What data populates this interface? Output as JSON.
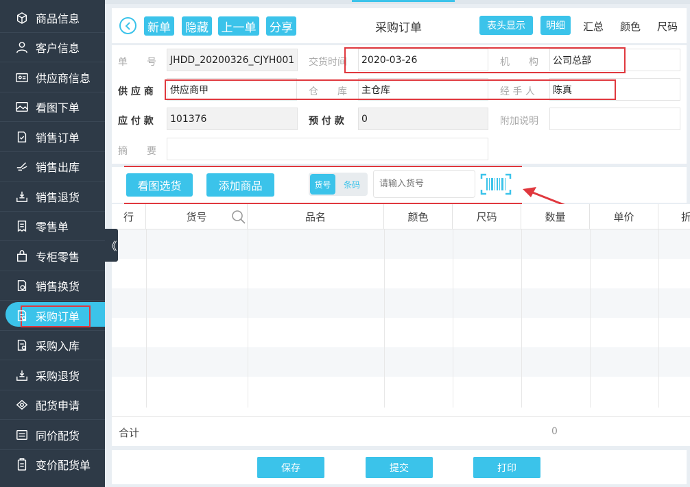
{
  "sidebar": {
    "items": [
      {
        "label": "商品信息",
        "icon": "box-icon"
      },
      {
        "label": "客户信息",
        "icon": "person-icon"
      },
      {
        "label": "供应商信息",
        "icon": "id-card-icon"
      },
      {
        "label": "看图下单",
        "icon": "image-icon"
      },
      {
        "label": "销售订单",
        "icon": "order-check-icon"
      },
      {
        "label": "销售出库",
        "icon": "hand-out-icon"
      },
      {
        "label": "销售退货",
        "icon": "tray-return-icon"
      },
      {
        "label": "零售单",
        "icon": "receipt-icon"
      },
      {
        "label": "专柜零售",
        "icon": "bag-icon"
      },
      {
        "label": "销售换货",
        "icon": "exchange-icon"
      },
      {
        "label": "采购订单",
        "icon": "purchase-order-icon"
      },
      {
        "label": "采购入库",
        "icon": "purchase-in-icon"
      },
      {
        "label": "采购退货",
        "icon": "purchase-return-icon"
      },
      {
        "label": "配货申请",
        "icon": "apply-icon"
      },
      {
        "label": "同价配货",
        "icon": "same-price-icon"
      },
      {
        "label": "变价配货单",
        "icon": "clipboard-icon"
      }
    ],
    "active_index": 10,
    "collapse_glyph": "《"
  },
  "header": {
    "back_glyph": "<",
    "new_label": "新单",
    "hide_label": "隐藏",
    "prev_label": "上一单",
    "share_label": "分享",
    "title": "采购订单",
    "header_display_label": "表头显示",
    "tabs": [
      "明细",
      "汇总",
      "颜色",
      "尺码"
    ],
    "active_tab": "明细"
  },
  "form": {
    "order_no_label": "单　　号",
    "order_no": "JHDD_20200326_CJYH001",
    "delivery_label": "交货时间",
    "delivery_date": "2020-03-26",
    "org_label": "机　　构",
    "org": "公司总部",
    "supplier_label": "供 应 商",
    "supplier": "供应商甲",
    "warehouse_label": "仓　　库",
    "warehouse": "主仓库",
    "handler_label": "经 手 人",
    "handler": "陈真",
    "payable_label": "应 付 款",
    "payable": "101376",
    "prepaid_label": "预 付 款",
    "prepaid": "0",
    "note_label": "附加说明",
    "summary_label": "摘　　要"
  },
  "toolbar": {
    "view_select_label": "看图选货",
    "add_goods_label": "添加商品",
    "seg_item_no": "货号",
    "seg_barcode": "条码",
    "search_placeholder": "请输入货号"
  },
  "table": {
    "columns": [
      "行",
      "货号",
      "品名",
      "颜色",
      "尺码",
      "数量",
      "单价",
      "折"
    ],
    "total_label": "合计",
    "total_qty": "0"
  },
  "footer": {
    "save_label": "保存",
    "submit_label": "提交",
    "print_label": "打印"
  },
  "colors": {
    "accent": "#3bc3ea",
    "sidebar_bg": "#2e3a47",
    "highlight_red": "#e0383e"
  }
}
